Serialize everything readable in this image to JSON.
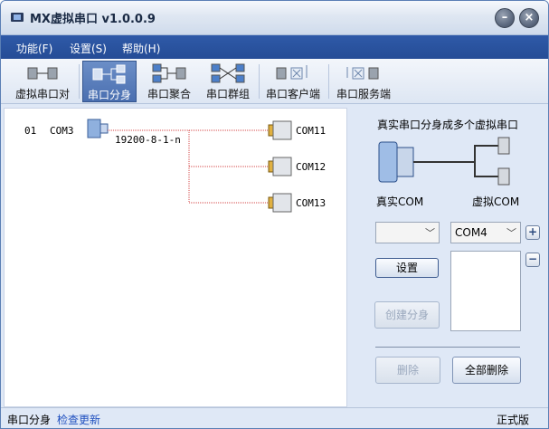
{
  "window": {
    "title": "MX虚拟串口  v1.0.0.9"
  },
  "menu": {
    "items": [
      "功能(F)",
      "设置(S)",
      "帮助(H)"
    ]
  },
  "toolbar": {
    "items": [
      {
        "label": "虚拟串口对",
        "icon": "serial-pair-icon"
      },
      {
        "label": "串口分身",
        "icon": "serial-split-icon"
      },
      {
        "label": "串口聚合",
        "icon": "serial-merge-icon"
      },
      {
        "label": "串口群组",
        "icon": "serial-group-icon"
      },
      {
        "label": "串口客户端",
        "icon": "serial-client-icon"
      },
      {
        "label": "串口服务端",
        "icon": "serial-server-icon"
      }
    ],
    "active_index": 1
  },
  "diagram": {
    "index": "01",
    "source_port": "COM3",
    "settings": "19200-8-1-n",
    "targets": [
      "COM11",
      "COM12",
      "COM13"
    ],
    "line_color": "#d44a4a"
  },
  "panel": {
    "title": "真实串口分身成多个虚拟串口",
    "real_caption": "真实COM",
    "virtual_caption": "虚拟COM",
    "real_combo_value": "",
    "virtual_combo_value": "COM4",
    "setup_button": "设置",
    "create_button": "创建分身",
    "delete_button": "删除",
    "delete_all_button": "全部删除",
    "add_symbol": "+",
    "remove_symbol": "−"
  },
  "status": {
    "mode": "串口分身",
    "check_update": "检查更新",
    "edition": "正式版",
    "link_color": "#1f4fbf"
  }
}
